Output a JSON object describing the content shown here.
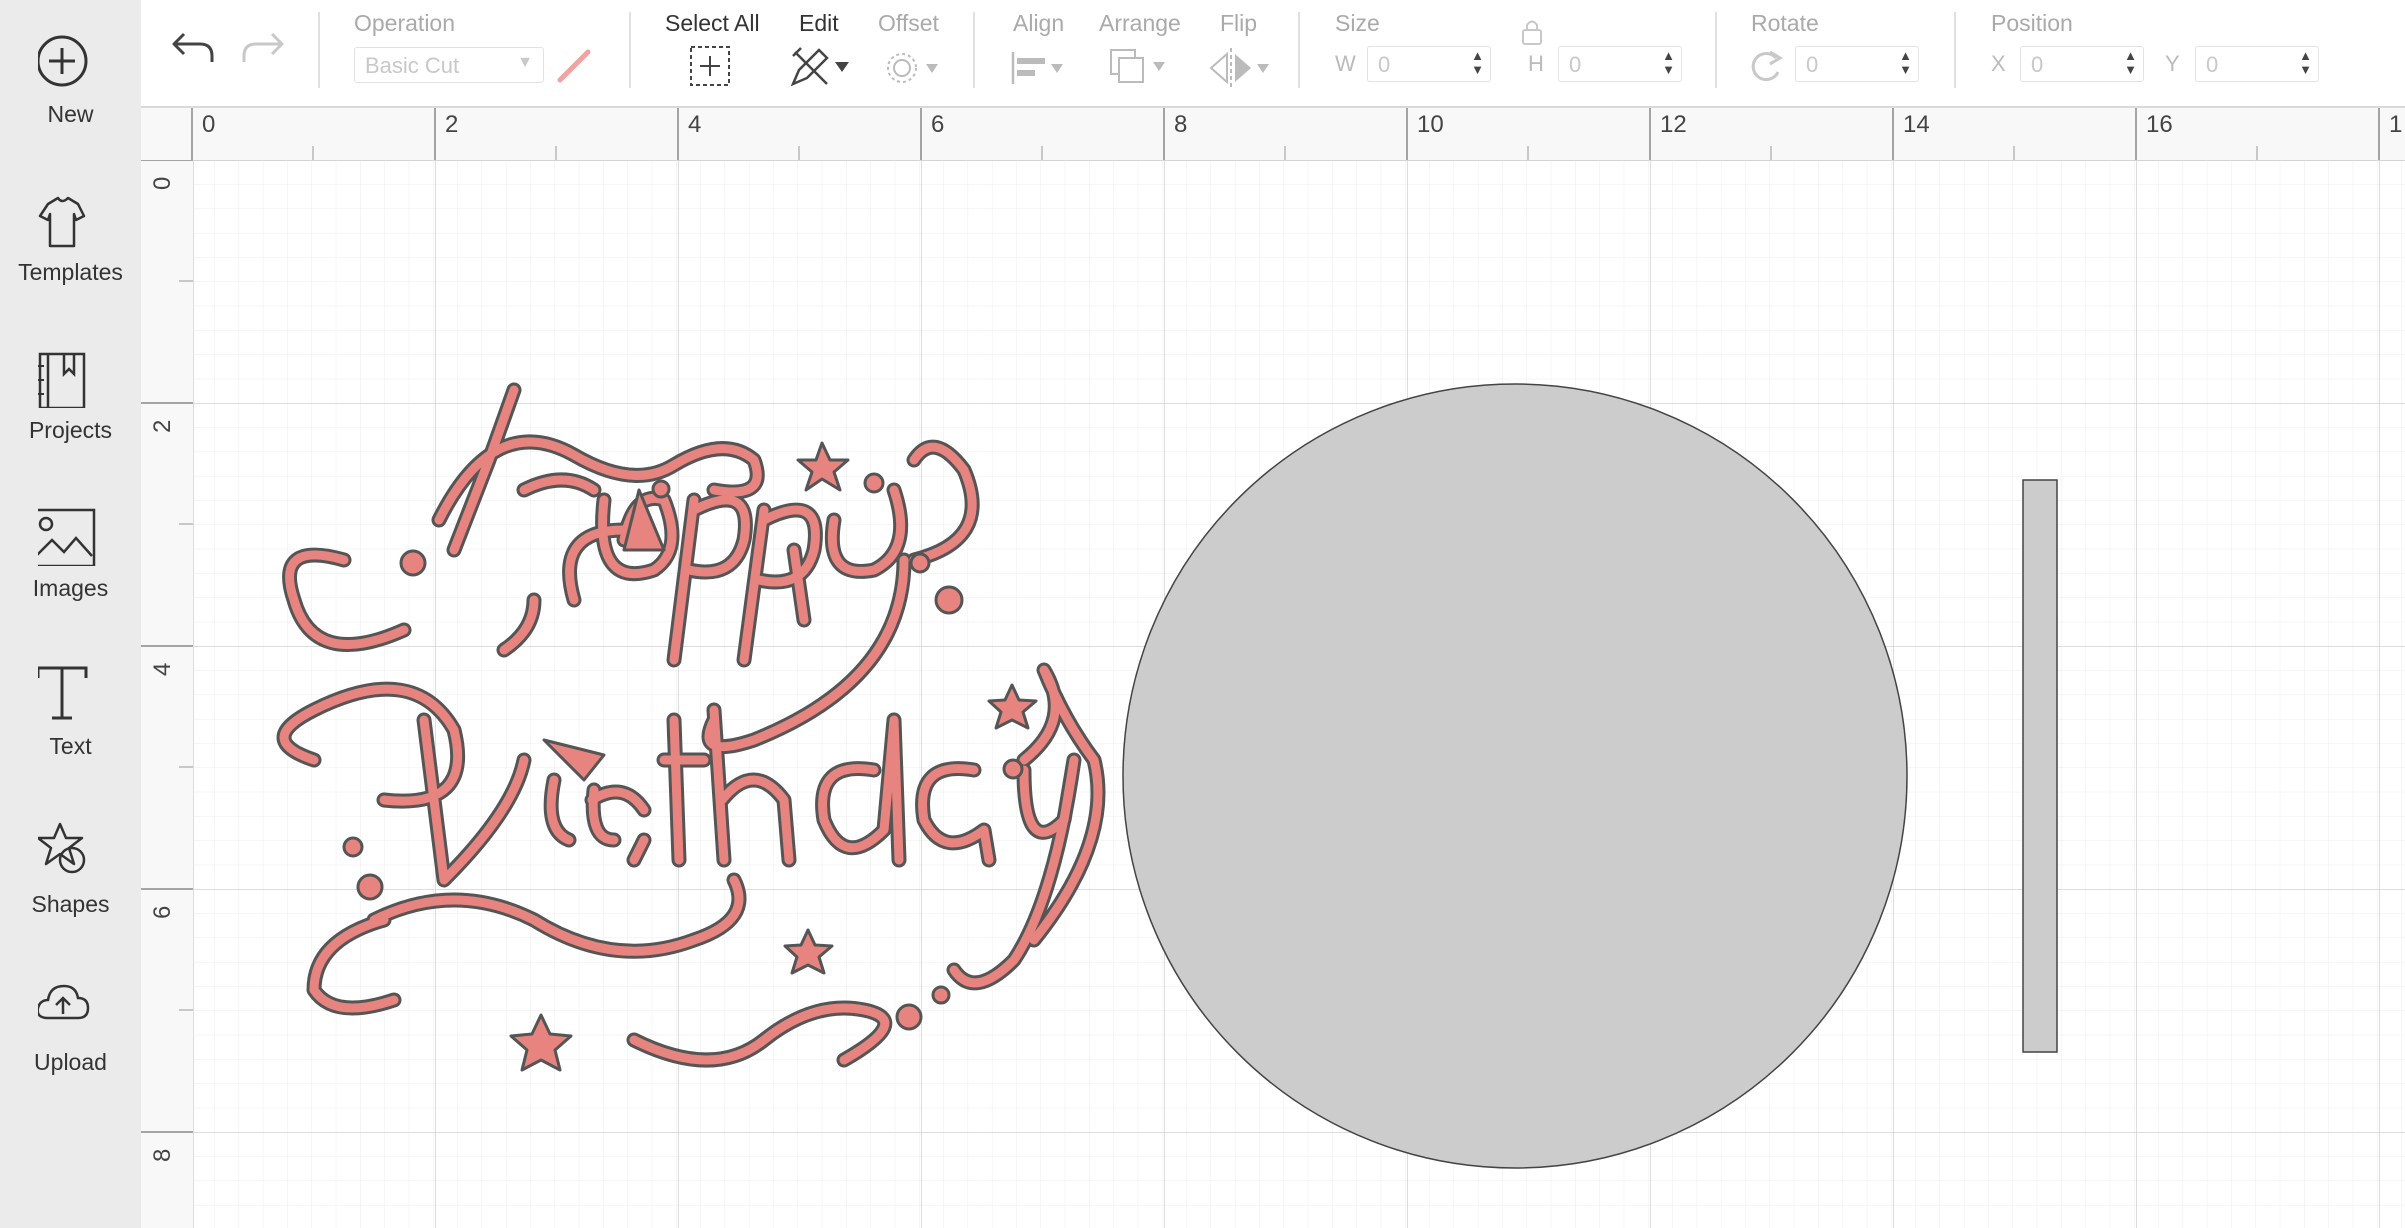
{
  "sidebar": {
    "items": [
      {
        "label": "New",
        "icon": "plus-circle-icon"
      },
      {
        "label": "Templates",
        "icon": "tshirt-icon"
      },
      {
        "label": "Projects",
        "icon": "notebook-icon"
      },
      {
        "label": "Images",
        "icon": "image-icon"
      },
      {
        "label": "Text",
        "icon": "text-t-icon"
      },
      {
        "label": "Shapes",
        "icon": "shapes-icon"
      },
      {
        "label": "Upload",
        "icon": "cloud-upload-icon"
      }
    ]
  },
  "toolbar": {
    "operation": {
      "title": "Operation",
      "value": "Basic Cut"
    },
    "select_all": {
      "title": "Select All"
    },
    "edit": {
      "title": "Edit"
    },
    "offset": {
      "title": "Offset"
    },
    "align": {
      "title": "Align"
    },
    "arrange": {
      "title": "Arrange"
    },
    "flip": {
      "title": "Flip"
    },
    "size": {
      "title": "Size",
      "w_label": "W",
      "w_value": "0",
      "h_label": "H",
      "h_value": "0"
    },
    "rotate": {
      "title": "Rotate",
      "value": "0"
    },
    "position": {
      "title": "Position",
      "x_label": "X",
      "x_value": "0",
      "y_label": "Y",
      "y_value": "0"
    }
  },
  "ruler": {
    "top": [
      "0",
      "2",
      "4",
      "6",
      "8",
      "10",
      "12",
      "14",
      "16",
      "1"
    ],
    "left": [
      "0",
      "2",
      "4",
      "6",
      "8"
    ]
  },
  "canvas": {
    "design_words": [
      "Happy",
      "Birthday"
    ]
  },
  "colors": {
    "accent": "#e8847f",
    "sidebar_bg": "#ebebeb",
    "shape_fill": "#cccccc",
    "grid_major": "#d4d4d4",
    "grid_minor": "#ececec"
  }
}
